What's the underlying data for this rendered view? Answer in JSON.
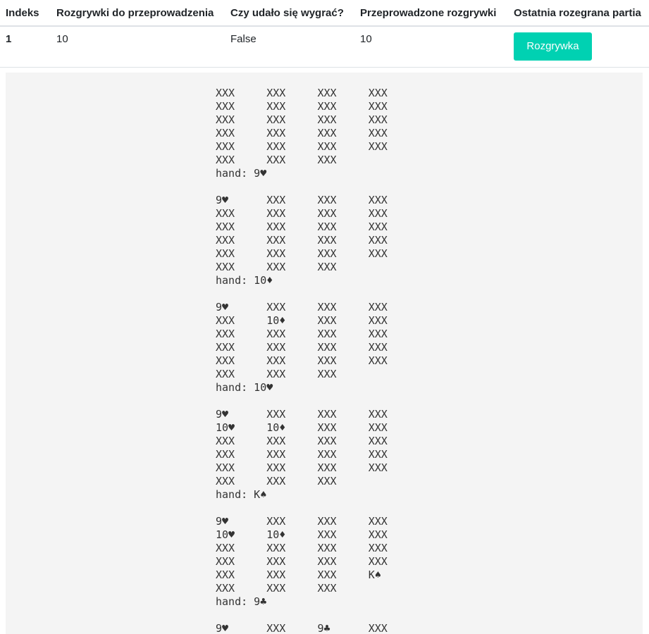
{
  "table": {
    "headers": {
      "index": "Indeks",
      "games_to_run": "Rozgrywki do przeprowadzenia",
      "won": "Czy udało się wygrać?",
      "games_run": "Przeprowadzone rozgrywki",
      "last_game": "Ostatnia rozegrana partia"
    },
    "rows": [
      {
        "index": "1",
        "games_to_run": "10",
        "won": "False",
        "games_run": "10",
        "button_label": "Rozgrywka"
      }
    ]
  },
  "game_log": [
    "XXX     XXX     XXX     XXX",
    "XXX     XXX     XXX     XXX",
    "XXX     XXX     XXX     XXX",
    "XXX     XXX     XXX     XXX",
    "XXX     XXX     XXX     XXX",
    "XXX     XXX     XXX",
    "hand: 9♥",
    "",
    "9♥      XXX     XXX     XXX",
    "XXX     XXX     XXX     XXX",
    "XXX     XXX     XXX     XXX",
    "XXX     XXX     XXX     XXX",
    "XXX     XXX     XXX     XXX",
    "XXX     XXX     XXX",
    "hand: 10♦",
    "",
    "9♥      XXX     XXX     XXX",
    "XXX     10♦     XXX     XXX",
    "XXX     XXX     XXX     XXX",
    "XXX     XXX     XXX     XXX",
    "XXX     XXX     XXX     XXX",
    "XXX     XXX     XXX",
    "hand: 10♥",
    "",
    "9♥      XXX     XXX     XXX",
    "10♥     10♦     XXX     XXX",
    "XXX     XXX     XXX     XXX",
    "XXX     XXX     XXX     XXX",
    "XXX     XXX     XXX     XXX",
    "XXX     XXX     XXX",
    "hand: K♠",
    "",
    "9♥      XXX     XXX     XXX",
    "10♥     10♦     XXX     XXX",
    "XXX     XXX     XXX     XXX",
    "XXX     XXX     XXX     XXX",
    "XXX     XXX     XXX     K♠",
    "XXX     XXX     XXX",
    "hand: 9♣",
    "",
    "9♥      XXX     9♣      XXX"
  ],
  "colors": {
    "button_bg": "#00d1b2",
    "panel_bg": "#f4f4f4",
    "header_border": "#dee2e6"
  }
}
